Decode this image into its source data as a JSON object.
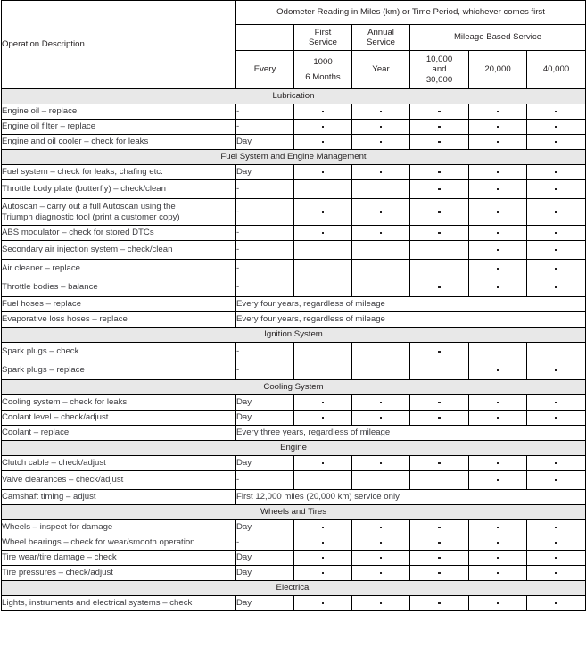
{
  "table": {
    "header": {
      "operation_description": "Operation Description",
      "odometer_title": "Odometer Reading in Miles (km) or Time Period, whichever comes first",
      "groups": {
        "blank": "",
        "first_service": [
          "First",
          "Service"
        ],
        "annual_service": [
          "Annual",
          "Service"
        ],
        "mileage_based_service": "Mileage Based Service"
      },
      "intervals": {
        "every": "Every",
        "first_service": [
          "1000",
          "6 Months"
        ],
        "annual_service": "Year",
        "mileage_1": [
          "10,000",
          "and",
          "30,000"
        ],
        "mileage_2": "20,000",
        "mileage_3": "40,000"
      }
    },
    "marks": {
      "dot": "•",
      "dash": "-"
    },
    "sections": [
      {
        "title": "Lubrication",
        "rows": [
          {
            "operation": "Engine oil – replace",
            "every": "-",
            "cells": [
              "dot",
              "dot",
              "dot",
              "dot",
              "dot"
            ]
          },
          {
            "operation": "Engine oil filter – replace",
            "every": "-",
            "cells": [
              "dot",
              "dot",
              "dot",
              "dot",
              "dot"
            ]
          },
          {
            "operation": "Engine and oil cooler – check for leaks",
            "every": "Day",
            "cells": [
              "dot",
              "dot",
              "dot",
              "dot",
              "dot"
            ]
          }
        ]
      },
      {
        "title": "Fuel System and Engine Management",
        "rows": [
          {
            "operation": "Fuel system – check for leaks, chafing etc.",
            "every": "Day",
            "cells": [
              "dot",
              "dot",
              "dot",
              "dot",
              "dot"
            ]
          },
          {
            "operation": "Throttle body plate (butterfly) – check/clean",
            "every": "-",
            "cells": [
              "",
              "",
              "dot",
              "dot",
              "dot"
            ]
          },
          {
            "operation": "Autoscan – carry out a full Autoscan using the Triumph diagnostic tool (print a customer copy)",
            "operation_lines": [
              "Autoscan – carry out a full Autoscan using the",
              "Triumph diagnostic tool (print a customer copy)"
            ],
            "every": "-",
            "cells": [
              "dot",
              "dot",
              "dot",
              "dot",
              "dot"
            ]
          },
          {
            "operation": "ABS modulator – check for stored DTCs",
            "every": "-",
            "cells": [
              "dot",
              "dot",
              "dot",
              "dot",
              "dot"
            ]
          },
          {
            "operation": "Secondary air injection system – check/clean",
            "every": "-",
            "cells": [
              "",
              "",
              "",
              "dot",
              "dot"
            ]
          },
          {
            "operation": "Air cleaner – replace",
            "every": "-",
            "cells": [
              "",
              "",
              "",
              "dot",
              "dot"
            ]
          },
          {
            "operation": "Throttle bodies – balance",
            "every": "-",
            "cells": [
              "",
              "",
              "dot",
              "dot",
              "dot"
            ]
          },
          {
            "operation": "Fuel hoses – replace",
            "note": "Every four years, regardless of mileage"
          },
          {
            "operation": "Evaporative loss hoses – replace",
            "note": "Every four years, regardless of mileage"
          }
        ]
      },
      {
        "title": "Ignition System",
        "rows": [
          {
            "operation": "Spark plugs – check",
            "every": "-",
            "cells": [
              "",
              "",
              "dot",
              "",
              ""
            ]
          },
          {
            "operation": "Spark plugs – replace",
            "every": "-",
            "cells": [
              "",
              "",
              "",
              "dot",
              "dot"
            ]
          }
        ]
      },
      {
        "title": "Cooling System",
        "rows": [
          {
            "operation": "Cooling system – check for leaks",
            "every": "Day",
            "cells": [
              "dot",
              "dot",
              "dot",
              "dot",
              "dot"
            ]
          },
          {
            "operation": "Coolant level – check/adjust",
            "every": "Day",
            "cells": [
              "dot",
              "dot",
              "dot",
              "dot",
              "dot"
            ]
          },
          {
            "operation": "Coolant – replace",
            "note": "Every three years, regardless of mileage"
          }
        ]
      },
      {
        "title": "Engine",
        "rows": [
          {
            "operation": "Clutch cable – check/adjust",
            "every": "Day",
            "cells": [
              "dot",
              "dot",
              "dot",
              "dot",
              "dot"
            ]
          },
          {
            "operation": "Valve clearances – check/adjust",
            "every": "-",
            "cells": [
              "",
              "",
              "",
              "dot",
              "dot"
            ]
          },
          {
            "operation": "Camshaft timing – adjust",
            "note": "First 12,000 miles (20,000 km) service only"
          }
        ]
      },
      {
        "title": "Wheels and Tires",
        "rows": [
          {
            "operation": "Wheels – inspect for damage",
            "every": "Day",
            "cells": [
              "dot",
              "dot",
              "dot",
              "dot",
              "dot"
            ]
          },
          {
            "operation": "Wheel bearings – check for wear/smooth operation",
            "every": "-",
            "cells": [
              "dot",
              "dot",
              "dot",
              "dot",
              "dot"
            ]
          },
          {
            "operation": "Tire wear/tire damage – check",
            "every": "Day",
            "cells": [
              "dot",
              "dot",
              "dot",
              "dot",
              "dot"
            ]
          },
          {
            "operation": "Tire pressures – check/adjust",
            "every": "Day",
            "cells": [
              "dot",
              "dot",
              "dot",
              "dot",
              "dot"
            ]
          }
        ]
      },
      {
        "title": "Electrical",
        "rows": [
          {
            "operation": "Lights, instruments and electrical systems – check",
            "every": "Day",
            "cells": [
              "dot",
              "dot",
              "dot",
              "dot",
              "dot"
            ]
          }
        ]
      }
    ]
  }
}
